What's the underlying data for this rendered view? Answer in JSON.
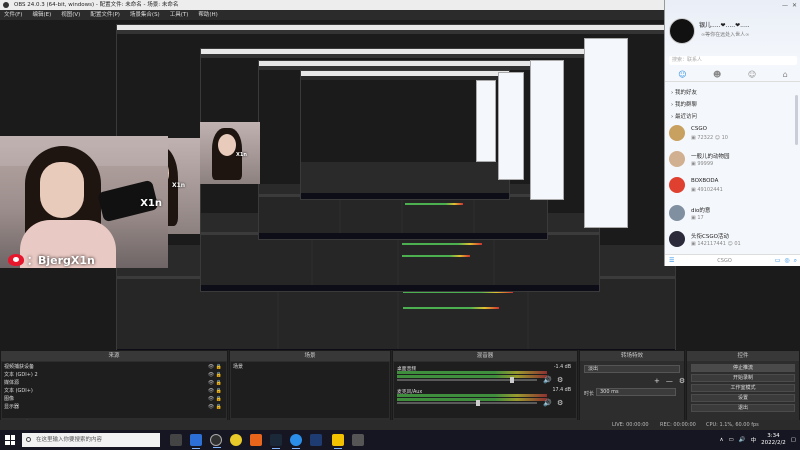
{
  "window": {
    "title": "OBS 24.0.3 (64-bit, windows) - 配置文件: 未命名 - 场景: 未命名"
  },
  "menu": [
    "文件(F)",
    "编辑(E)",
    "视图(V)",
    "配置文件(P)",
    "场景集合(S)",
    "工具(T)",
    "帮助(H)"
  ],
  "overlay": {
    "webcam_text": "X1n",
    "weibo_handle": "：BjergX1n"
  },
  "qq": {
    "name": "银儿.....❤.....❤.....",
    "signature": "∞等你在远处入世人∞",
    "win_buttons": [
      "—",
      "✕"
    ],
    "search_placeholder": "搜索：联系人",
    "tabs": [
      "☺",
      "☻",
      "☺",
      "⌂"
    ],
    "groups": [
      "› 我的好友",
      "› 我的群聊",
      "› 最近访问"
    ],
    "contacts": [
      {
        "name": "CSGO",
        "status": "▣ 72322  ☺ 10",
        "color": "#c8a060"
      },
      {
        "name": "一般儿的动物园",
        "status": "▣ 99999",
        "color": "#d0b090"
      },
      {
        "name": "BOXBODA",
        "status": "▣ 49102441",
        "color": "#e04030"
      },
      {
        "name": "dio的意",
        "status": "▣ 17",
        "color": "#8090a0"
      },
      {
        "name": "头衔CSGO活动",
        "status": "▣ 142117441  ☺ 01",
        "color": "#2a2a3a"
      }
    ],
    "footer_left": "☰",
    "footer_label": "CSGO",
    "footer_right": [
      "▭",
      "◎",
      "⌕"
    ]
  },
  "docks": {
    "sources": {
      "title": "来源",
      "items": [
        "视频捕获设备",
        "文本 (GDI+) 2",
        "媒体源",
        "文本 (GDI+)",
        "图像",
        "显示器"
      ],
      "footer": [
        "+",
        "—",
        "⚙",
        "∧",
        "∨"
      ]
    },
    "scenes": {
      "title": "场景",
      "items": [
        "场景"
      ],
      "footer": [
        "+",
        "—",
        "∧",
        "∨"
      ]
    },
    "mixer": {
      "title": "混音器",
      "channels": [
        {
          "name": "桌面音频",
          "db": "-1.4 dB",
          "level": 0.82
        },
        {
          "name": "麦克风/Aux",
          "db": "17.4 dB",
          "level": 0.58
        }
      ],
      "mute_icon": "🔊",
      "gear_icon": "⚙"
    },
    "transitions": {
      "title": "转场特效",
      "selected": "淡出",
      "duration_label": "时长",
      "duration_value": "300 ms",
      "add": "+",
      "remove": "—",
      "gear": "⚙"
    },
    "controls": {
      "title": "控件",
      "buttons": [
        "停止推流",
        "开始录制",
        "工作室模式",
        "设置",
        "退出"
      ]
    }
  },
  "status": {
    "live": "LIVE: 00:00:00",
    "rec": "REC: 00:00:00",
    "cpu": "CPU: 1.1%, 60.00 fps"
  },
  "taskbar": {
    "search_placeholder": "在这里输入你要搜索的内容",
    "time": "3:34",
    "date": "2022/2/2",
    "lang": "中"
  }
}
